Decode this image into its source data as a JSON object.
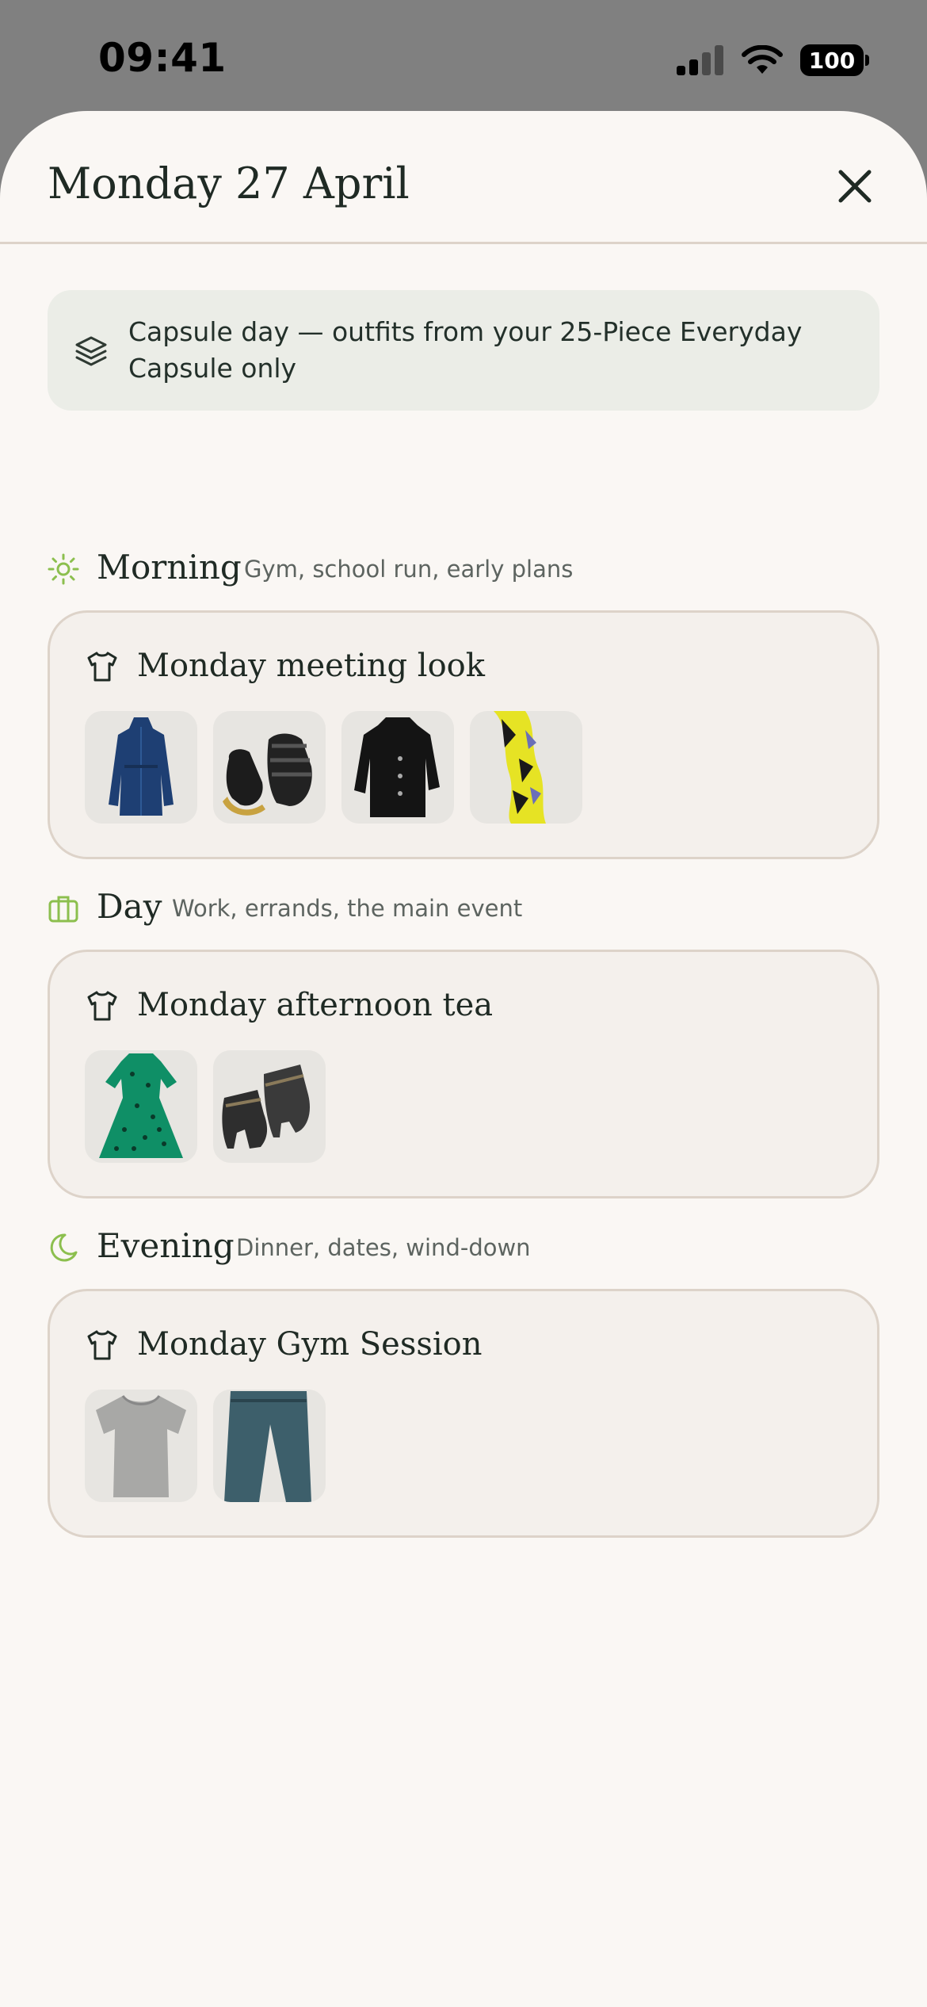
{
  "status_bar": {
    "time": "09:41",
    "battery": "100"
  },
  "header": {
    "title": "Monday 27 April"
  },
  "capsule_banner": {
    "text": "Capsule day — outfits from your 25-Piece Everyday Capsule only",
    "icon": "layers-icon"
  },
  "sections": [
    {
      "title": "Morning",
      "subtitle": "Gym, school run, early plans",
      "icon": "sun-icon",
      "outfit": {
        "name": "Monday meeting look",
        "items": [
          "denim-shirt-dress",
          "black-platform-sandals",
          "black-coat",
          "yellow-print-scarf"
        ]
      }
    },
    {
      "title": "Day",
      "subtitle": "Work, errands, the main event",
      "icon": "briefcase-icon",
      "outfit": {
        "name": "Monday afternoon tea",
        "items": [
          "green-polka-dot-dress",
          "grey-buckle-ankle-boots"
        ]
      }
    },
    {
      "title": "Evening",
      "subtitle": "Dinner, dates, wind-down",
      "icon": "moon-icon",
      "outfit": {
        "name": "Monday Gym Session",
        "items": [
          "grey-t-shirt",
          "blue-jeans"
        ]
      }
    }
  ],
  "colors": {
    "accent_green": "#8cbf4e",
    "sheet_bg": "#faf7f4",
    "card_bg": "#f4f0ec",
    "card_border": "#ddd3c9",
    "banner_bg": "#ebede7"
  }
}
